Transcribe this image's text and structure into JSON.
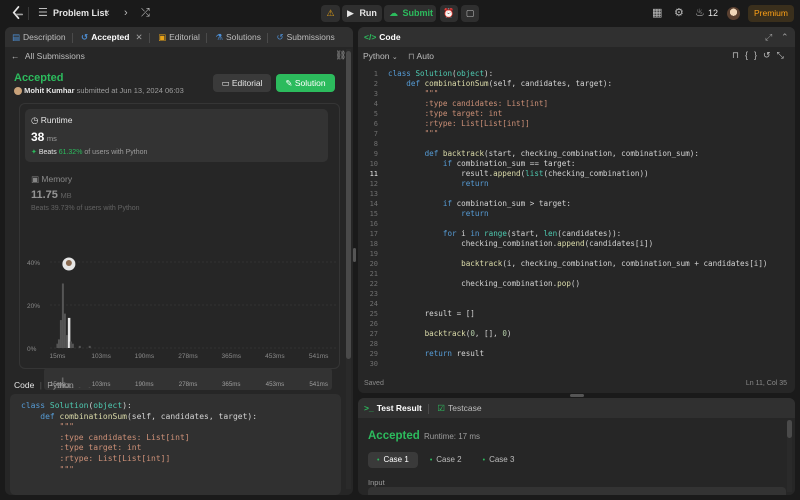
{
  "nav": {
    "problem_list": "Problem List",
    "run": "Run",
    "submit": "Submit",
    "streak": "12",
    "premium": "Premium"
  },
  "left": {
    "tabs": {
      "description": "Description",
      "accepted": "Accepted",
      "editorial": "Editorial",
      "solutions": "Solutions",
      "submissions": "Submissions"
    },
    "all_submissions": "All Submissions",
    "status": "Accepted",
    "author": "Mohit Kumhar",
    "submitted": "submitted at Jun 13, 2024 06:03",
    "editorial_btn": "Editorial",
    "solution_btn": "Solution",
    "runtime": {
      "label": "Runtime",
      "value": "38",
      "unit": "ms",
      "beats_label": "Beats",
      "beats_value": "61.32%",
      "beats_suffix": "of users with Python"
    },
    "memory": {
      "label": "Memory",
      "value": "11.75",
      "unit": "MB",
      "beats_text": "Beats 39.73% of users with Python"
    },
    "code_header": "Code",
    "code_lang": "Python",
    "code_preview": [
      "class Solution(object):",
      "    def combinationSum(self, candidates, target):",
      "        \"\"\"",
      "        :type candidates: List[int]",
      "        :type target: int",
      "        :rtype: List[List[int]]",
      "        \"\"\""
    ]
  },
  "chart_data": {
    "type": "bar",
    "y_ticks": [
      "40%",
      "20%",
      "0%"
    ],
    "ylim": [
      0,
      40
    ],
    "x_ticks": [
      "15ms",
      "103ms",
      "190ms",
      "278ms",
      "365ms",
      "453ms",
      "541ms"
    ],
    "bars": [
      {
        "x": 15,
        "value": 2
      },
      {
        "x": 18,
        "value": 4
      },
      {
        "x": 22,
        "value": 13
      },
      {
        "x": 26,
        "value": 30
      },
      {
        "x": 30,
        "value": 16
      },
      {
        "x": 34,
        "value": 6
      },
      {
        "x": 38,
        "value": 14
      },
      {
        "x": 42,
        "value": 3
      },
      {
        "x": 46,
        "value": 2
      },
      {
        "x": 60,
        "value": 1
      },
      {
        "x": 80,
        "value": 1
      }
    ],
    "highlight_x": 38
  },
  "editor": {
    "title": "Code",
    "lang": "Python",
    "auto": "Auto",
    "saved": "Saved",
    "cursor": "Ln 11, Col 35",
    "lines": [
      "class Solution(object):",
      "    def combinationSum(self, candidates, target):",
      "        \"\"\"",
      "        :type candidates: List[int]",
      "        :type target: int",
      "        :rtype: List[List[int]]",
      "        \"\"\"",
      "",
      "        def backtrack(start, checking_combination, combination_sum):",
      "            if combination_sum == target:",
      "                result.append(list(checking_combination))",
      "                return",
      "",
      "            if combination_sum > target:",
      "                return",
      "",
      "            for i in range(start, len(candidates)):",
      "                checking_combination.append(candidates[i])",
      "",
      "                backtrack(i, checking_combination, combination_sum + candidates[i])",
      "",
      "                checking_combination.pop()",
      "",
      "",
      "        result = []",
      "",
      "        backtrack(0, [], 0)",
      "",
      "        return result",
      ""
    ]
  },
  "result": {
    "tab_result": "Test Result",
    "tab_testcase": "Testcase",
    "status": "Accepted",
    "runtime": "Runtime: 17 ms",
    "cases": [
      "Case 1",
      "Case 2",
      "Case 3"
    ],
    "input_label": "Input"
  }
}
